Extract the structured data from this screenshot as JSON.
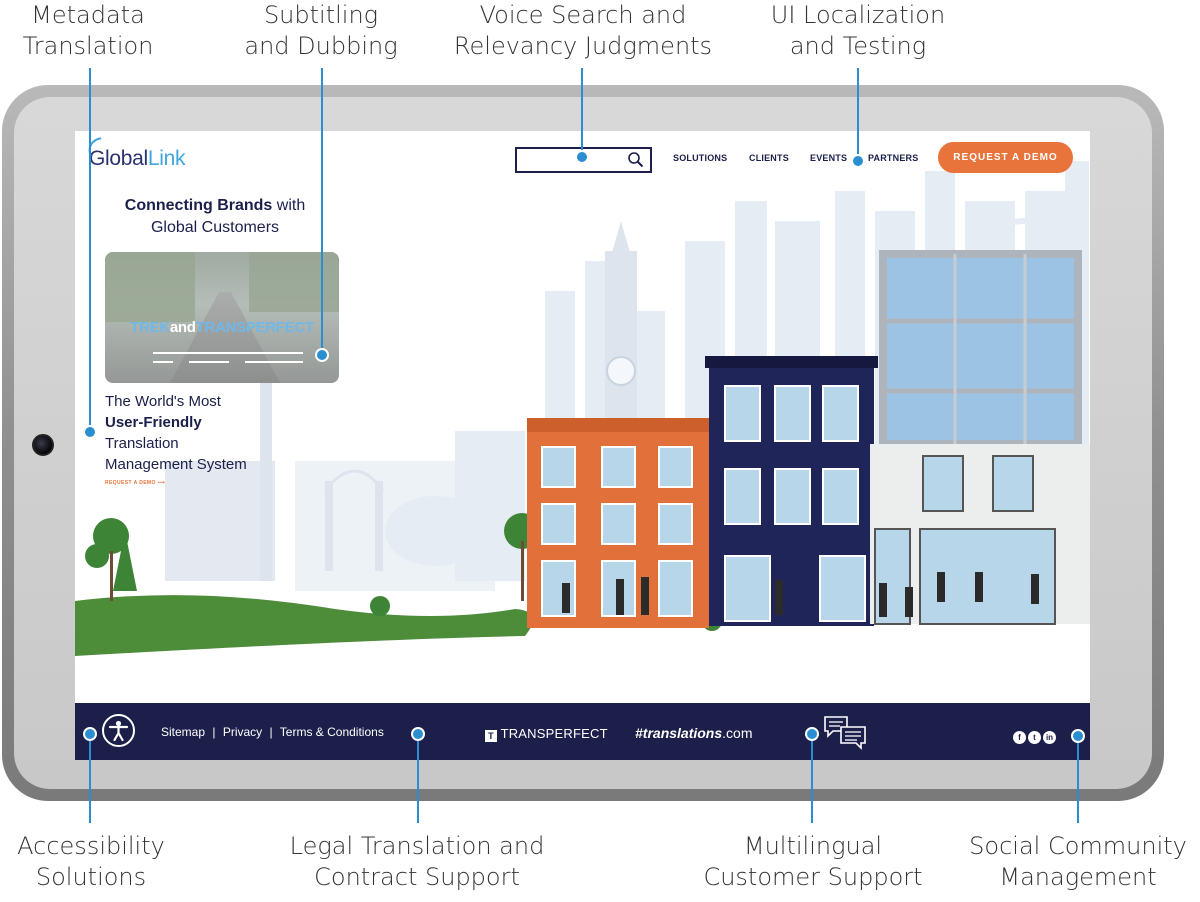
{
  "callouts": {
    "metadata": [
      "Metadata",
      "Translation"
    ],
    "subtitling": [
      "Subtitling",
      "and Dubbing"
    ],
    "voice_search": [
      "Voice Search and",
      "Relevancy Judgments"
    ],
    "ui_localization": [
      "UI Localization",
      "and Testing"
    ],
    "accessibility": [
      "Accessibility",
      "Solutions"
    ],
    "legal": [
      "Legal Translation and",
      "Contract Support"
    ],
    "multilingual": [
      "Multilingual",
      "Customer Support"
    ],
    "social": [
      "Social Community",
      "Management"
    ]
  },
  "header": {
    "logo_main": "Gl",
    "logo_rest": "bal",
    "logo_link": "Link",
    "search_placeholder": "",
    "nav": [
      "SOLUTIONS",
      "CLIENTS",
      "EVENTS",
      "PARTNERS"
    ],
    "cta": "REQUEST A DEMO"
  },
  "hero": {
    "title_bold": "Connecting Brands",
    "title_rest": " with",
    "title_line2": "Global Customers",
    "video_title_a": "TREK",
    "video_title_b": "and",
    "video_title_c": "TRANSPERFECT",
    "tagline_1": "The World's Most",
    "tagline_2": "User-Friendly",
    "tagline_3": "Translation",
    "tagline_4": "Management System",
    "request_link": "REQUEST A DEMO ⟶"
  },
  "footer": {
    "links": [
      "Sitemap",
      "|",
      "Privacy",
      "|",
      "Terms & Conditions"
    ],
    "transperfect": "TRANSPERFECT",
    "translations_main": "translations",
    "translations_com": ".com",
    "social": [
      "f",
      "t",
      "in"
    ]
  },
  "colors": {
    "navy": "#1b1f4a",
    "accent_orange": "#e8743b",
    "callout_blue": "#2a8fd1",
    "logo_blue": "#3fa3dc"
  }
}
